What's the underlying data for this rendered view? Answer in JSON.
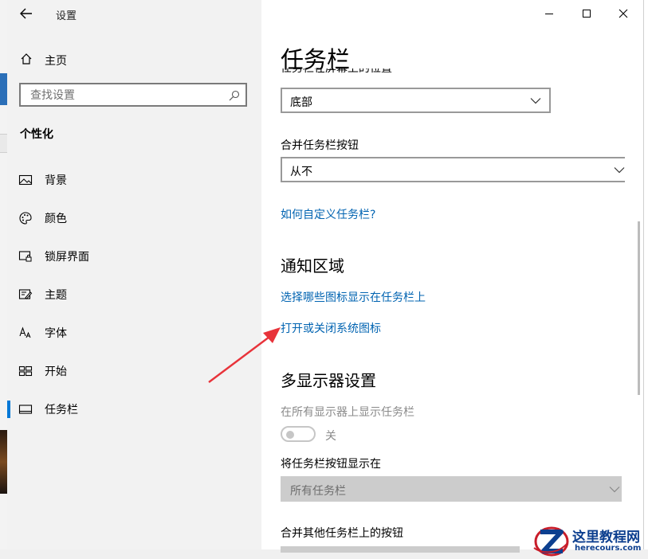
{
  "window": {
    "title": "设置"
  },
  "controls": {
    "minimize": "minimize",
    "maximize": "maximize",
    "close": "close"
  },
  "sidebar": {
    "home_label": "主页",
    "search_placeholder": "查找设置",
    "section_title": "个性化",
    "items": [
      {
        "label": "背景",
        "icon": "image-icon"
      },
      {
        "label": "颜色",
        "icon": "palette-icon"
      },
      {
        "label": "锁屏界面",
        "icon": "lock-screen-icon"
      },
      {
        "label": "主题",
        "icon": "theme-icon"
      },
      {
        "label": "字体",
        "icon": "font-icon"
      },
      {
        "label": "开始",
        "icon": "start-icon"
      },
      {
        "label": "任务栏",
        "icon": "taskbar-icon",
        "active": true
      }
    ]
  },
  "main": {
    "title": "任务栏",
    "partial_text": "任务栏在屏幕上的位置",
    "position_value": "底部",
    "combine_label": "合并任务栏按钮",
    "combine_value": "从不",
    "help_link": "如何自定义任务栏?",
    "notification_heading": "通知区域",
    "notif_link1": "选择哪些图标显示在任务栏上",
    "notif_link2": "打开或关闭系统图标",
    "multi_heading": "多显示器设置",
    "multi_show_label": "在所有显示器上显示任务栏",
    "toggle_state": "关",
    "show_buttons_label": "将任务栏按钮显示在",
    "show_buttons_value": "所有任务栏",
    "combine_other_label": "合并其他任务栏上的按钮"
  },
  "colors": {
    "accent": "#0078d7",
    "link": "#0063b1",
    "annotation_arrow": "#e8333a"
  },
  "watermark": {
    "title": "这里教程网",
    "subtitle": "herecours.com"
  }
}
